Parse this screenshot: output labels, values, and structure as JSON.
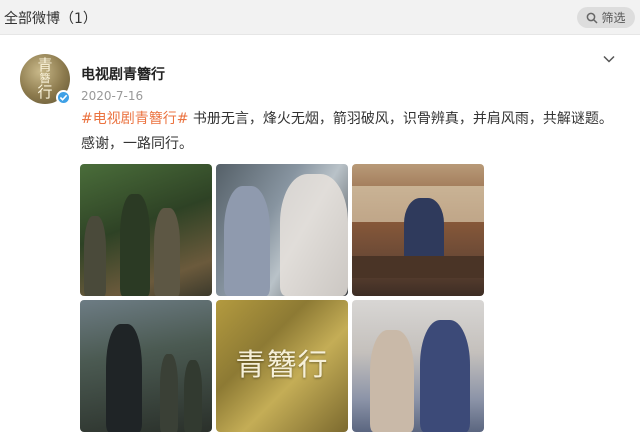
{
  "topbar": {
    "title": "全部微博（1）",
    "filter_label": "筛选"
  },
  "post": {
    "avatar_text": [
      "青",
      "簪",
      "行"
    ],
    "username": "电视剧青簪行",
    "date": "2020-7-16",
    "hashtag": "#电视剧青簪行#",
    "body": " 书册无言，烽火无烟，箭羽破风，识骨辨真，并肩风雨，共解谜题。感谢，一路同行。"
  },
  "images": [
    {
      "name": "still-1"
    },
    {
      "name": "still-2"
    },
    {
      "name": "still-3"
    },
    {
      "name": "still-4"
    },
    {
      "name": "title-card",
      "title_text": "青簪行"
    },
    {
      "name": "still-6"
    }
  ],
  "colors": {
    "hashtag": "#eb7340",
    "verified_badge": "#3ea0e6",
    "topbar_bg": "#f2f2f2"
  },
  "icons": {
    "filter": "search-icon",
    "more": "chevron-down-icon",
    "verified": "verified-check-icon"
  }
}
